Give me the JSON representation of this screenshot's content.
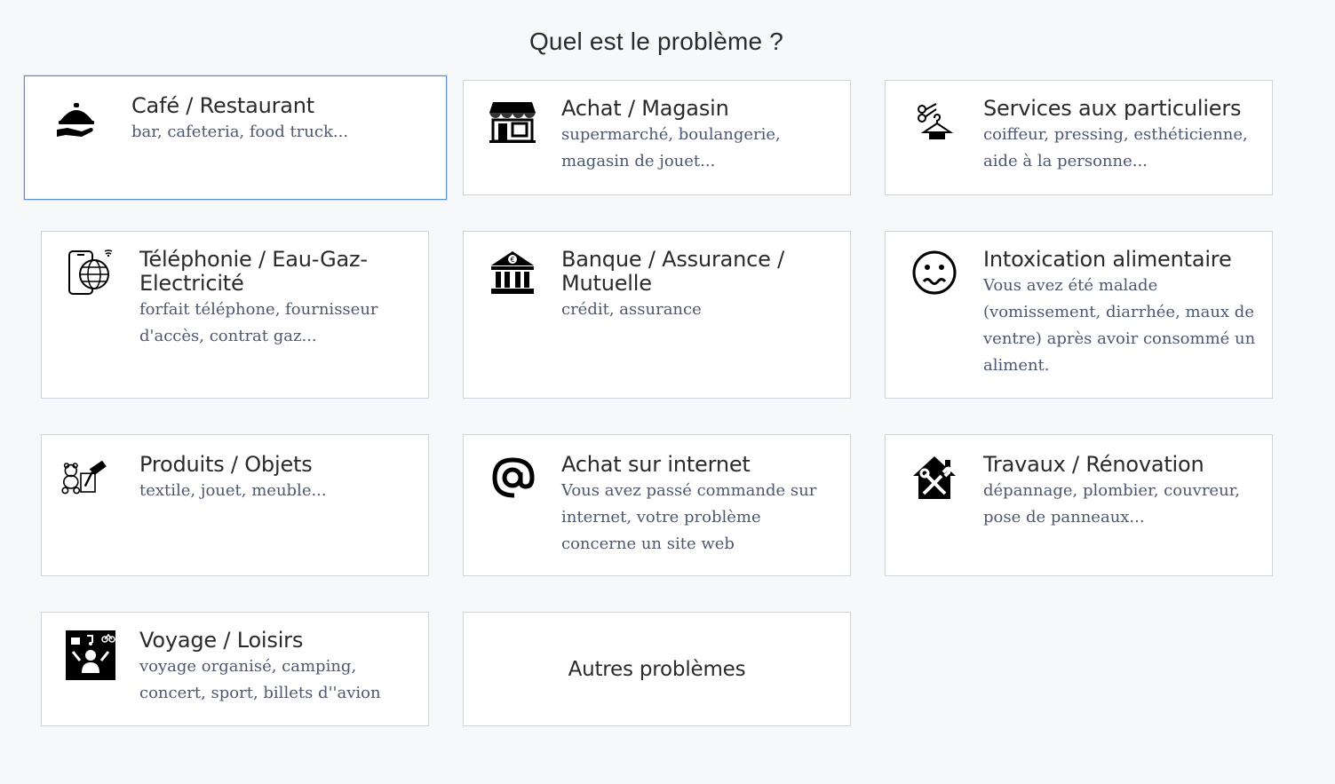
{
  "page": {
    "title": "Quel est le problème ?"
  },
  "cards": [
    {
      "title": "Café / Restaurant",
      "desc": "bar, cafeteria, food truck...",
      "icon": "cloche-serving-icon",
      "selected": true
    },
    {
      "title": "Achat / Magasin",
      "desc": "supermarché, boulangerie, magasin de jouet...",
      "icon": "storefront-icon"
    },
    {
      "title": "Services aux particuliers",
      "desc": "coiffeur, pressing, esthéticienne, aide à la personne...",
      "icon": "scissors-hanger-icon"
    },
    {
      "title": "Téléphonie / Eau-Gaz-Electricité",
      "desc": "forfait téléphone, fournisseur d'accès, contrat gaz...",
      "icon": "phone-globe-icon"
    },
    {
      "title": "Banque / Assurance / Mutuelle",
      "desc": "crédit, assurance",
      "icon": "bank-icon"
    },
    {
      "title": "Intoxication alimentaire",
      "desc": "Vous avez été malade (vomissement, diarrhée, maux de ventre) après avoir consommé un aliment.",
      "icon": "sick-face-icon"
    },
    {
      "title": "Produits / Objets",
      "desc": "textile, jouet, meuble...",
      "icon": "toys-tools-icon"
    },
    {
      "title": "Achat sur internet",
      "desc": "Vous avez passé commande sur internet, votre problème concerne un site web",
      "icon": "at-sign-icon"
    },
    {
      "title": "Travaux / Rénovation",
      "desc": "dépannage, plombier, couvreur, pose de panneaux...",
      "icon": "house-tools-icon"
    },
    {
      "title": "Voyage / Loisirs",
      "desc": "voyage organisé, camping, concert, sport, billets d''avion",
      "icon": "leisure-person-icon"
    },
    {
      "title": "Autres problèmes"
    }
  ]
}
